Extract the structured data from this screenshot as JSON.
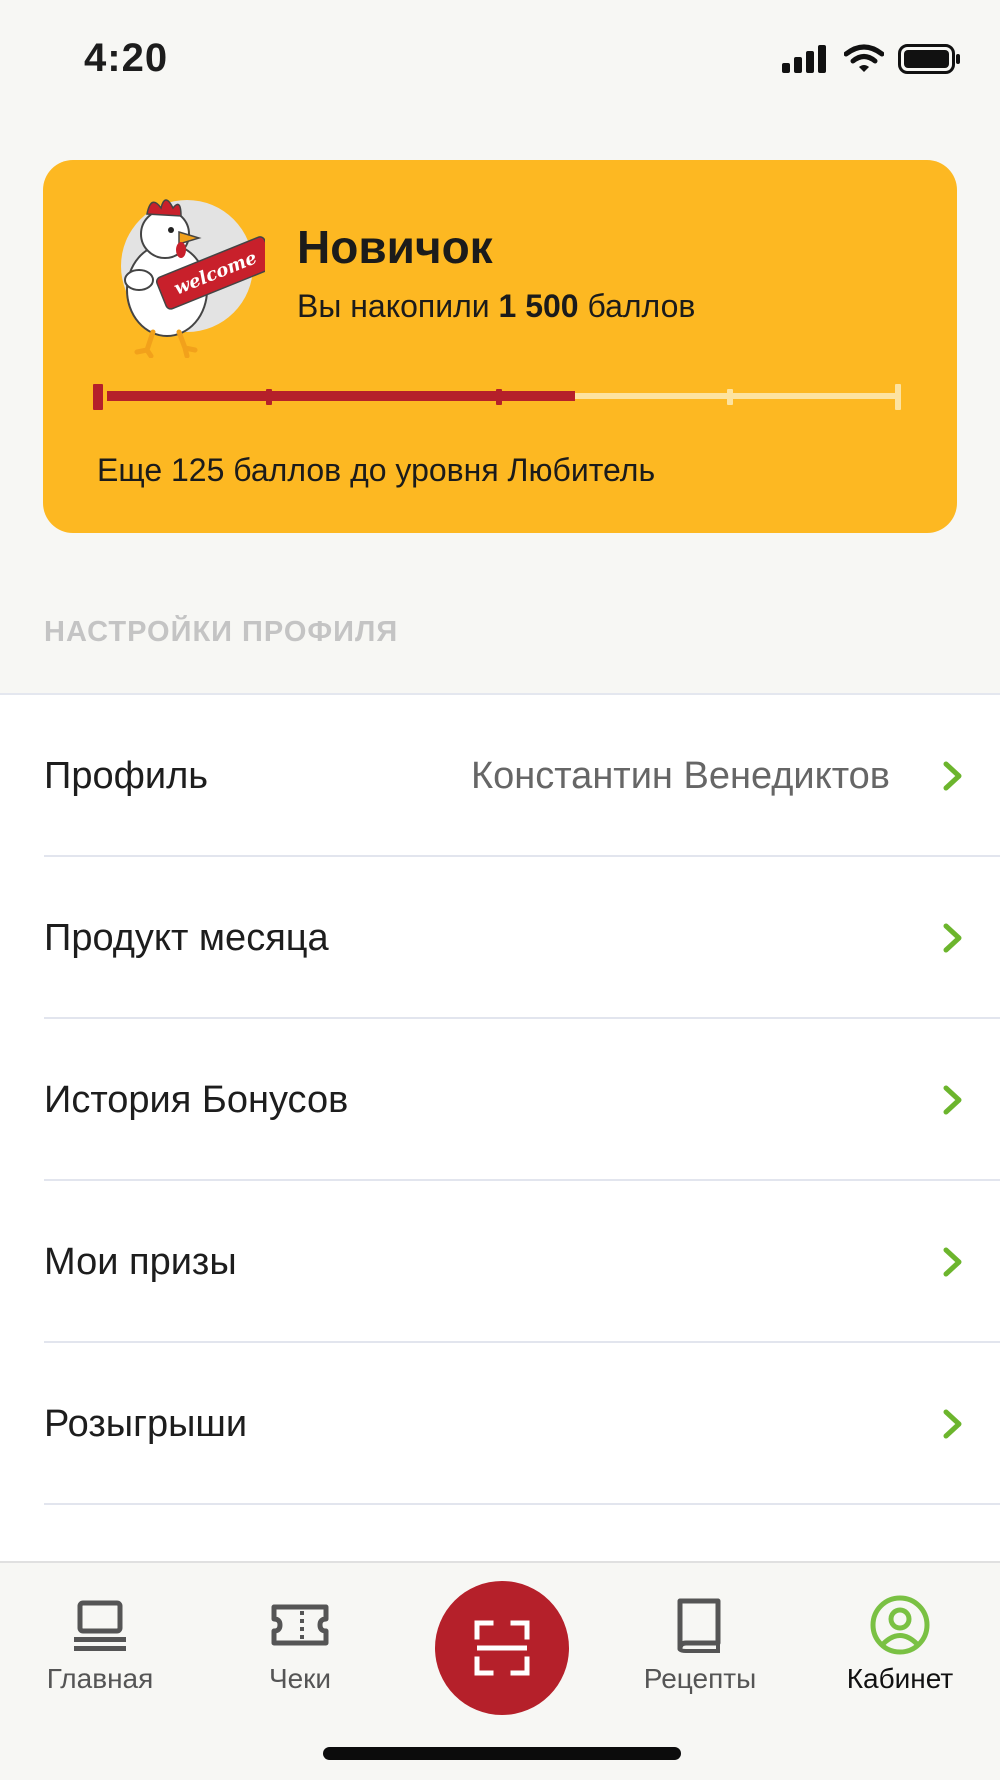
{
  "status_bar": {
    "time": "4:20"
  },
  "loyalty_card": {
    "level": "Новичок",
    "points_prefix": "Вы накопили",
    "points_value": "1 500",
    "points_suffix": "баллов",
    "progress_fraction": 0.59,
    "next_level_text": "Еще 125 баллов до уровня Любитель",
    "mascot_banner_text": "welcome"
  },
  "section": {
    "title": "НАСТРОЙКИ ПРОФИЛЯ"
  },
  "menu": {
    "items": [
      {
        "label": "Профиль",
        "value": "Константин Венедиктов"
      },
      {
        "label": "Продукт месяца",
        "value": ""
      },
      {
        "label": "История Бонусов",
        "value": ""
      },
      {
        "label": "Мои призы",
        "value": ""
      },
      {
        "label": "Розыгрыши",
        "value": ""
      }
    ]
  },
  "tabbar": {
    "tabs": [
      {
        "label": "Главная",
        "icon": "laptop-icon"
      },
      {
        "label": "Чеки",
        "icon": "ticket-icon"
      },
      {
        "label": "",
        "icon": "scan-icon"
      },
      {
        "label": "Рецепты",
        "icon": "book-icon"
      },
      {
        "label": "Кабинет",
        "icon": "user-circle-icon"
      }
    ],
    "active": "Кабинет"
  },
  "colors": {
    "card_bg": "#fdb822",
    "progress_filled": "#b5202a",
    "progress_empty": "#fde3a0",
    "chevron": "#6cb52d",
    "accent_active": "#7ac143",
    "scan_button": "#b5202a"
  }
}
